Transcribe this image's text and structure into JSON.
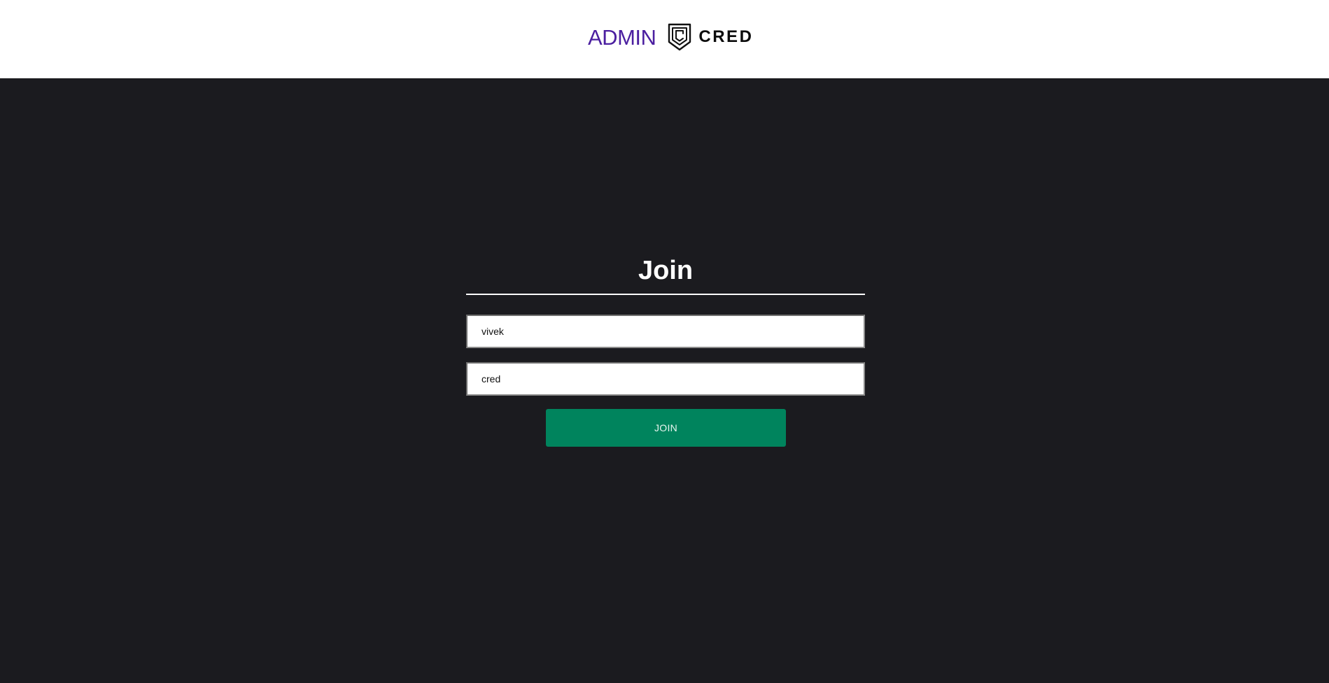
{
  "header": {
    "admin_text": "ADMIN",
    "logo_icon": "cred-shield-icon",
    "cred_text": "CRED"
  },
  "form": {
    "title": "Join",
    "username_value": "vivek",
    "password_value": "cred",
    "join_label": "JOIN"
  },
  "colors": {
    "header_bg": "#ffffff",
    "page_bg": "#1b1b1f",
    "admin_text": "#4b1fa0",
    "button_bg": "#00845d"
  }
}
